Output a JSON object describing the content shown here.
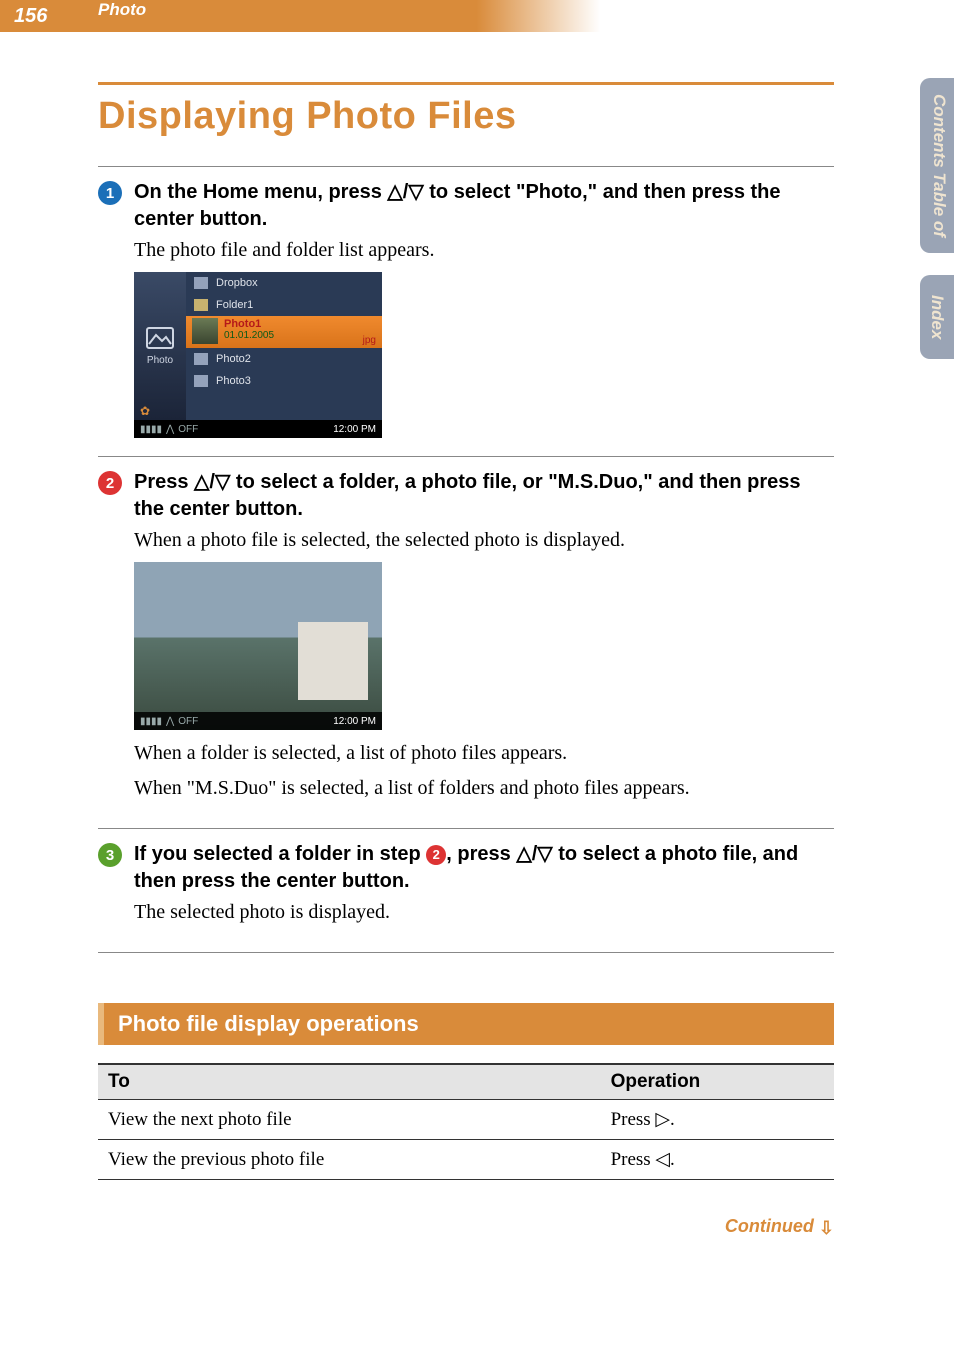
{
  "header": {
    "page_number": "156",
    "category": "Photo"
  },
  "side_tabs": {
    "toc_line1": "Table of",
    "toc_line2": "Contents",
    "index": "Index"
  },
  "title": "Displaying Photo Files",
  "steps": [
    {
      "num": "1",
      "heading": "On the Home menu, press △/▽ to select \"Photo,\" and then press the center button.",
      "desc": "The photo file and folder list appears."
    },
    {
      "num": "2",
      "heading": "Press △/▽ to select a folder, a photo file, or \"M.S.Duo,\" and then press the center button.",
      "desc": "When a photo file is selected, the selected photo is displayed.",
      "desc2a": "When a folder is selected, a list of photo files appears.",
      "desc2b": "When \"M.S.Duo\" is selected, a list of folders and photo files appears."
    },
    {
      "num": "3",
      "heading_pre": "If you selected a folder in step ",
      "heading_mid_ref": "2",
      "heading_post": ", press △/▽ to select a photo file, and then press the center button.",
      "desc": "The selected photo is displayed."
    }
  ],
  "device": {
    "left_label": "Photo",
    "items": {
      "dropbox": "Dropbox",
      "folder1": "Folder1",
      "photo1": "Photo1",
      "photo1_date": "01.01.2005",
      "photo1_ext": "jpg",
      "photo2": "Photo2",
      "photo3": "Photo3"
    },
    "status_off": "OFF",
    "clock": "12:00 PM"
  },
  "photo_mock": {
    "status_off": "OFF",
    "clock": "12:00 PM"
  },
  "subheader": "Photo file display operations",
  "table": {
    "head_to": "To",
    "head_op": "Operation",
    "rows": [
      {
        "to": "View the next photo file",
        "op": "Press ▷."
      },
      {
        "to": "View the previous photo file",
        "op": "Press ◁."
      }
    ]
  },
  "continued": "Continued ",
  "continued_arrow": "⇩"
}
